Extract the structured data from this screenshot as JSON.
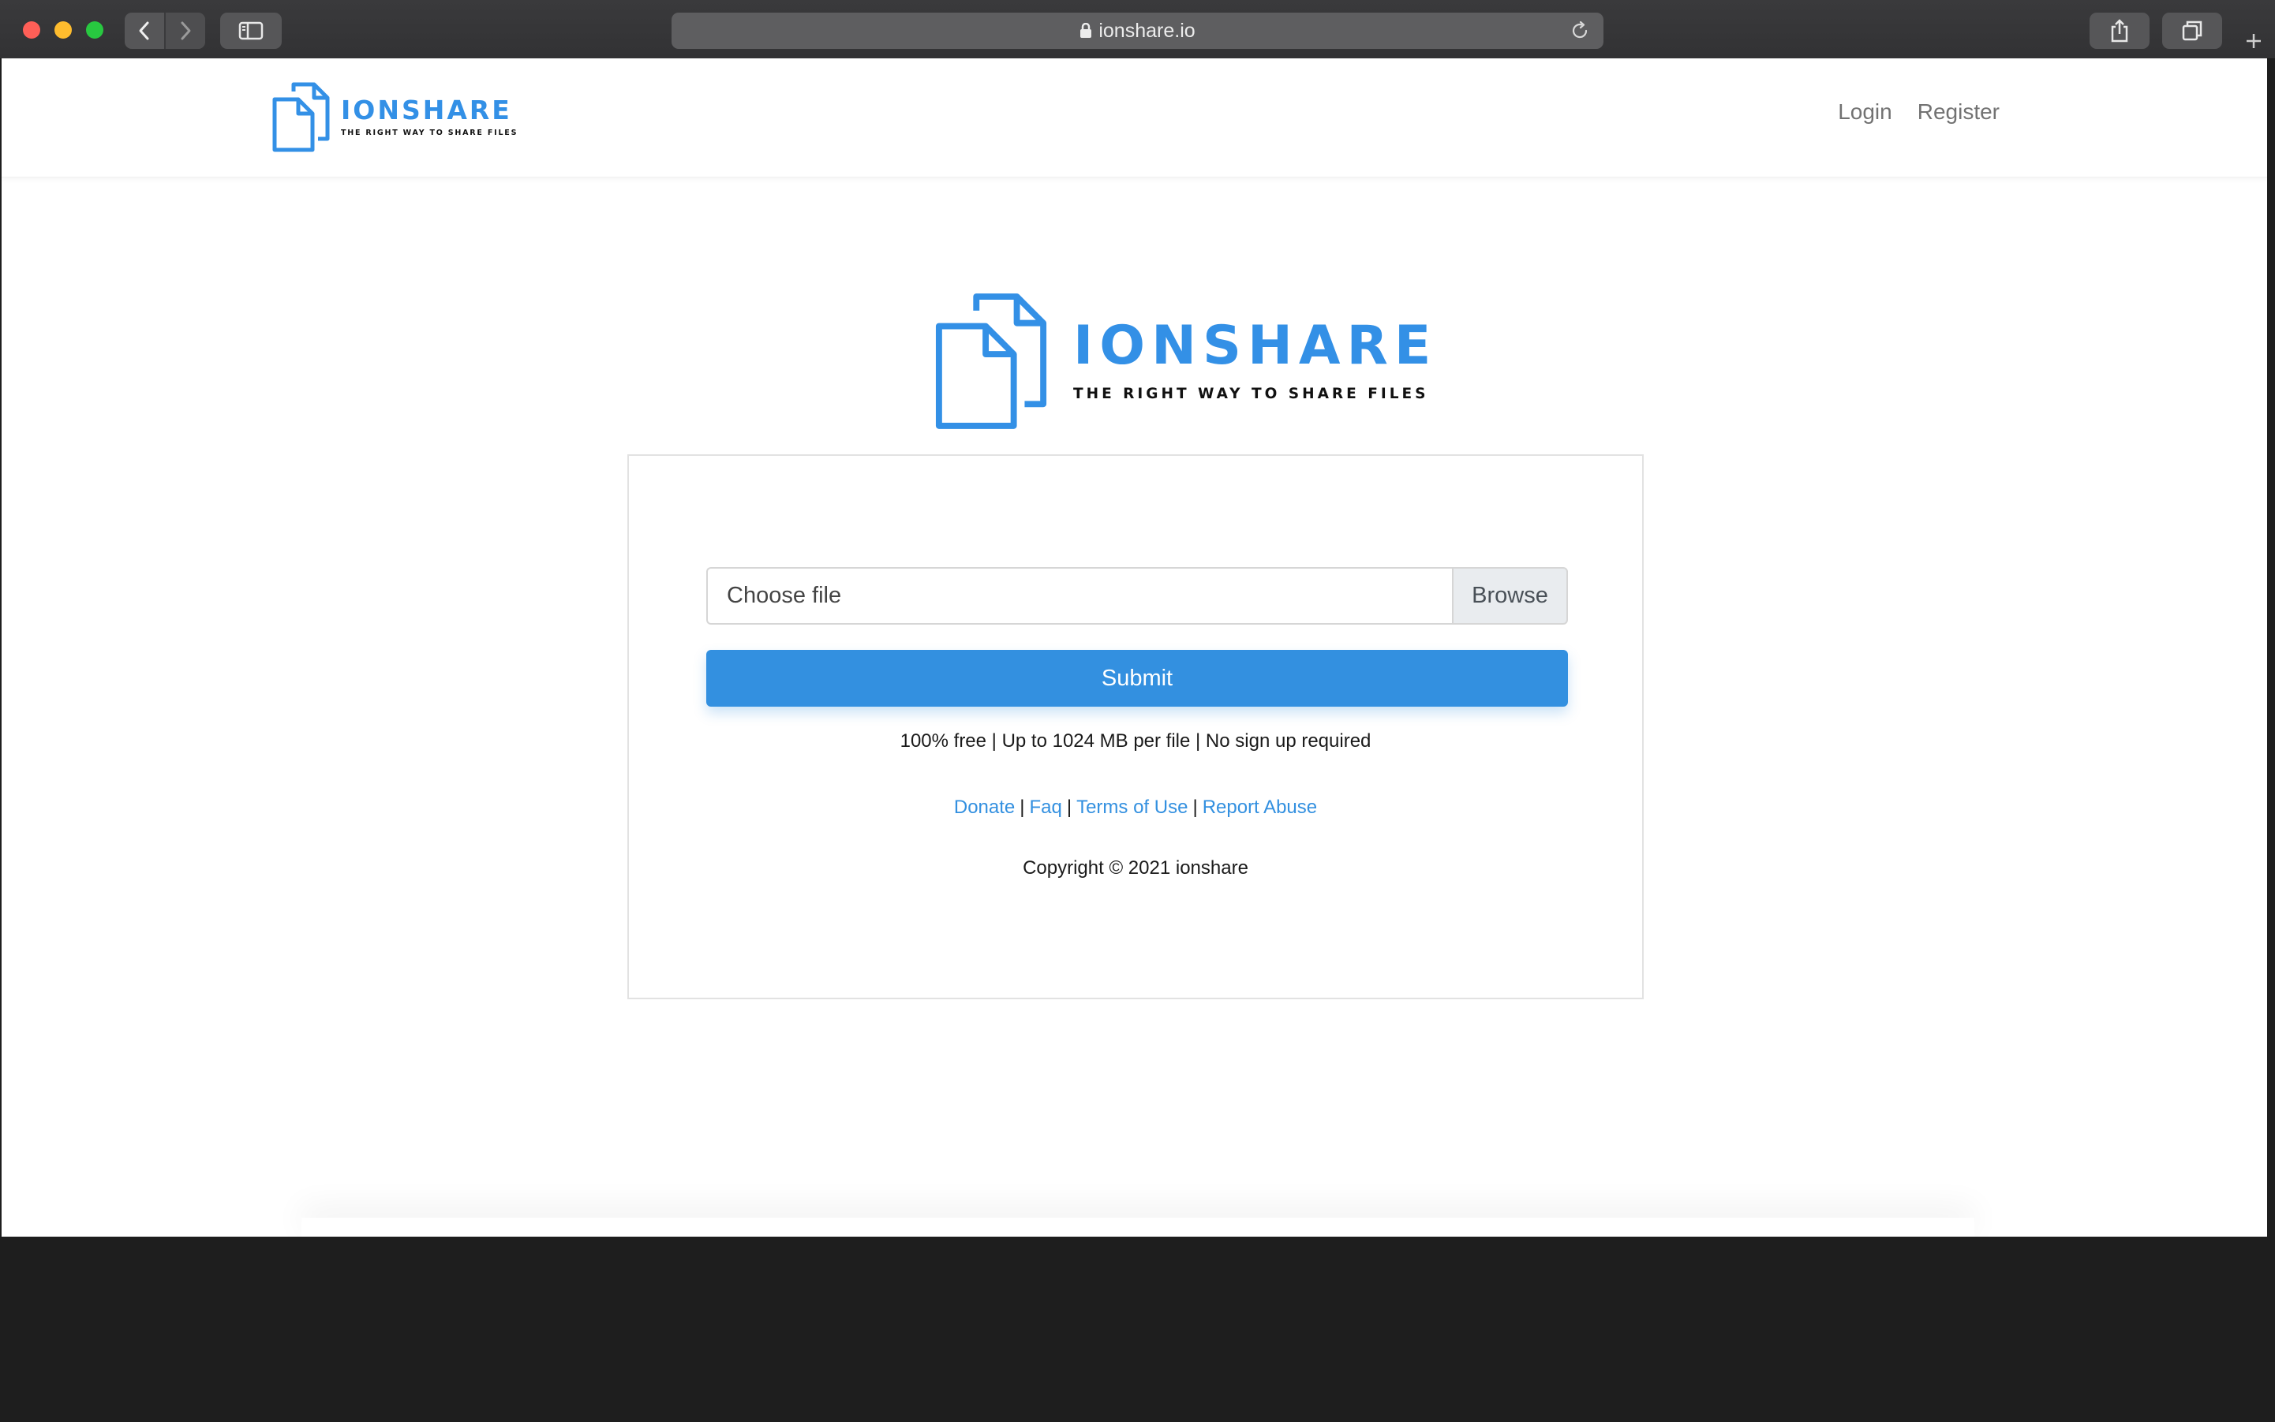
{
  "browser": {
    "url": "ionshare.io",
    "icons": [
      "back-icon",
      "forward-icon",
      "sidebar-icon",
      "lock-icon",
      "reload-icon",
      "share-icon",
      "tabs-icon",
      "plus-icon"
    ]
  },
  "header": {
    "logo": {
      "brand": "IONSHARE",
      "tagline": "THE RIGHT WAY TO SHARE FILES"
    },
    "nav": {
      "login": "Login",
      "register": "Register"
    }
  },
  "hero": {
    "brand": "IONSHARE",
    "tagline": "THE RIGHT WAY TO SHARE FILES"
  },
  "upload": {
    "file_placeholder": "Choose file",
    "browse_label": "Browse",
    "submit_label": "Submit",
    "info": "100% free | Up to 1024 MB per file | No sign up required"
  },
  "footer": {
    "links": {
      "donate": "Donate",
      "faq": "Faq",
      "terms": "Terms of Use",
      "report": "Report Abuse"
    },
    "separator": "|",
    "copyright": "Copyright © 2021 ionshare"
  },
  "colors": {
    "accent": "#3390e0",
    "brand": "#3390e6"
  }
}
